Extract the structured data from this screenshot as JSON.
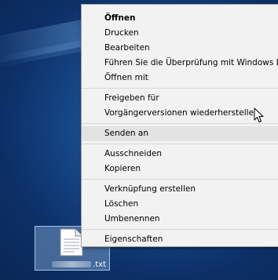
{
  "desktop": {
    "file": {
      "name_visible": ".txt",
      "icon": "text-file-icon"
    }
  },
  "context_menu": {
    "hover_index": 7,
    "groups": [
      [
        {
          "label": "Öffnen",
          "bold": true
        },
        {
          "label": "Drucken"
        },
        {
          "label": "Bearbeiten"
        },
        {
          "label": "Führen Sie die Überprüfung mit Windows Defender aus"
        },
        {
          "label": "Öffnen mit"
        }
      ],
      [
        {
          "label": "Freigeben für"
        },
        {
          "label": "Vorgängerversionen wiederherstellen"
        }
      ],
      [
        {
          "label": "Senden an"
        }
      ],
      [
        {
          "label": "Ausschneiden"
        },
        {
          "label": "Kopieren"
        }
      ],
      [
        {
          "label": "Verknüpfung erstellen"
        },
        {
          "label": "Löschen"
        },
        {
          "label": "Umbenennen"
        }
      ],
      [
        {
          "label": "Eigenschaften"
        }
      ]
    ]
  },
  "cursor": {
    "icon": "arrow-cursor-icon"
  }
}
